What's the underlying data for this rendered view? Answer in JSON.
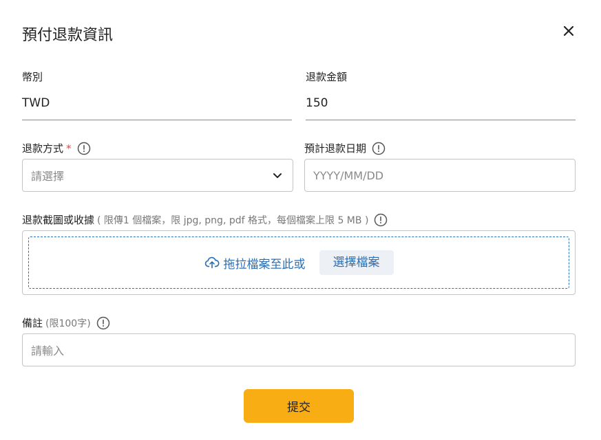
{
  "dialog": {
    "title": "預付退款資訊"
  },
  "currency": {
    "label": "幣別",
    "value": "TWD"
  },
  "refund_amount": {
    "label": "退款金額",
    "value": "150"
  },
  "refund_method": {
    "label": "退款方式",
    "required_mark": "*",
    "placeholder": "請選擇"
  },
  "refund_date": {
    "label": "預計退款日期",
    "placeholder": "YYYY/MM/DD"
  },
  "upload": {
    "label": "退款截圖或收據",
    "hint": "( 限傳1 個檔案，限 jpg, png, pdf 格式，每個檔案上限 5 MB )",
    "drag_text": "拖拉檔案至此或",
    "choose_label": "選擇檔案"
  },
  "notes": {
    "label": "備註",
    "hint": "(限100字)",
    "placeholder": "請輸入"
  },
  "submit": {
    "label": "提交"
  },
  "icons": {
    "close": "close-icon",
    "info": "info-circle-icon",
    "chevron": "chevron-down-icon",
    "upload": "cloud-upload-icon"
  },
  "colors": {
    "accent": "#2a6fb6",
    "submit": "#f9ad15",
    "required": "#e0454b"
  }
}
